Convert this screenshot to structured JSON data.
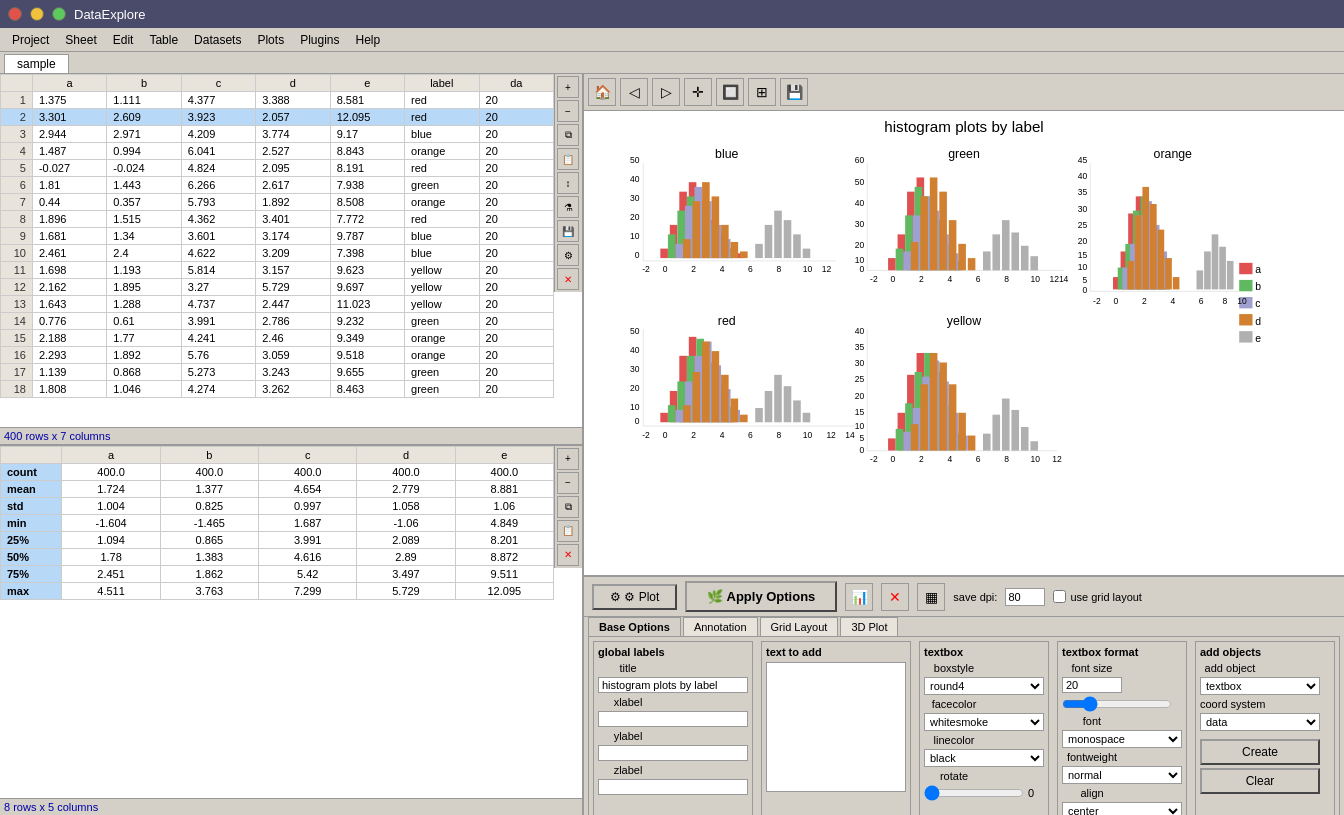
{
  "titlebar": {
    "title": "DataExplore"
  },
  "menu": {
    "items": [
      "Project",
      "Sheet",
      "Edit",
      "Table",
      "Datasets",
      "Plots",
      "Plugins",
      "Help"
    ]
  },
  "tab": {
    "label": "sample"
  },
  "table": {
    "columns": [
      "",
      "a",
      "b",
      "c",
      "d",
      "e",
      "label",
      "da"
    ],
    "rows": [
      [
        "1",
        "1.375",
        "1.111",
        "4.377",
        "3.388",
        "8.581",
        "red",
        "20"
      ],
      [
        "2",
        "3.301",
        "2.609",
        "3.923",
        "2.057",
        "12.095",
        "red",
        "20"
      ],
      [
        "3",
        "2.944",
        "2.971",
        "4.209",
        "3.774",
        "9.17",
        "blue",
        "20"
      ],
      [
        "4",
        "1.487",
        "0.994",
        "6.041",
        "2.527",
        "8.843",
        "orange",
        "20"
      ],
      [
        "5",
        "-0.027",
        "-0.024",
        "4.824",
        "2.095",
        "8.191",
        "red",
        "20"
      ],
      [
        "6",
        "1.81",
        "1.443",
        "6.266",
        "2.617",
        "7.938",
        "green",
        "20"
      ],
      [
        "7",
        "0.44",
        "0.357",
        "5.793",
        "1.892",
        "8.508",
        "orange",
        "20"
      ],
      [
        "8",
        "1.896",
        "1.515",
        "4.362",
        "3.401",
        "7.772",
        "red",
        "20"
      ],
      [
        "9",
        "1.681",
        "1.34",
        "3.601",
        "3.174",
        "9.787",
        "blue",
        "20"
      ],
      [
        "10",
        "2.461",
        "2.4",
        "4.622",
        "3.209",
        "7.398",
        "blue",
        "20"
      ],
      [
        "11",
        "1.698",
        "1.193",
        "5.814",
        "3.157",
        "9.623",
        "yellow",
        "20"
      ],
      [
        "12",
        "2.162",
        "1.895",
        "3.27",
        "5.729",
        "9.697",
        "yellow",
        "20"
      ],
      [
        "13",
        "1.643",
        "1.288",
        "4.737",
        "2.447",
        "11.023",
        "yellow",
        "20"
      ],
      [
        "14",
        "0.776",
        "0.61",
        "3.991",
        "2.786",
        "9.232",
        "green",
        "20"
      ],
      [
        "15",
        "2.188",
        "1.77",
        "4.241",
        "2.46",
        "9.349",
        "orange",
        "20"
      ],
      [
        "16",
        "2.293",
        "1.892",
        "5.76",
        "3.059",
        "9.518",
        "orange",
        "20"
      ],
      [
        "17",
        "1.139",
        "0.868",
        "5.273",
        "3.243",
        "9.655",
        "green",
        "20"
      ],
      [
        "18",
        "1.808",
        "1.046",
        "4.274",
        "3.262",
        "8.463",
        "green",
        "20"
      ]
    ],
    "row_info": "400 rows x 7 columns"
  },
  "stats": {
    "columns": [
      "",
      "a",
      "b",
      "c",
      "d",
      "e"
    ],
    "rows": [
      [
        "count",
        "400.0",
        "400.0",
        "400.0",
        "400.0",
        "400.0"
      ],
      [
        "mean",
        "1.724",
        "1.377",
        "4.654",
        "2.779",
        "8.881"
      ],
      [
        "std",
        "1.004",
        "0.825",
        "0.997",
        "1.058",
        "1.06"
      ],
      [
        "min",
        "-1.604",
        "-1.465",
        "1.687",
        "-1.06",
        "4.849"
      ],
      [
        "25%",
        "1.094",
        "0.865",
        "3.991",
        "2.089",
        "8.201"
      ],
      [
        "50%",
        "1.78",
        "1.383",
        "4.616",
        "2.89",
        "8.872"
      ],
      [
        "75%",
        "2.451",
        "1.862",
        "5.42",
        "3.497",
        "9.511"
      ],
      [
        "max",
        "4.511",
        "3.763",
        "7.299",
        "5.729",
        "12.095"
      ]
    ],
    "row_info": "8 rows x 5 columns"
  },
  "plot": {
    "title": "histogram plots by label",
    "subplots": [
      "blue",
      "green",
      "orange",
      "red",
      "yellow"
    ]
  },
  "controls": {
    "plot_btn": "⚙ Plot",
    "apply_options_btn": "Apply Options",
    "save_dpi_label": "save dpi:",
    "save_dpi_value": "80",
    "use_grid_layout": "use grid layout",
    "grid_layout_label": "Grid Layout",
    "tabs": [
      "Base Options",
      "Annotation",
      "Grid Layout",
      "3D Plot"
    ],
    "global_labels": {
      "label": "global labels",
      "title_label": "title",
      "title_value": "histogram plots by label",
      "xlabel_label": "xlabel",
      "ylabel_label": "ylabel",
      "zlabel_label": "zlabel"
    },
    "text_to_add": {
      "label": "text to add"
    },
    "textbox": {
      "label": "textbox",
      "boxstyle_label": "boxstyle",
      "boxstyle_value": "round4",
      "facecolor_label": "facecolor",
      "facecolor_value": "whitesmoke",
      "linecolor_label": "linecolor",
      "linecolor_value": "black",
      "rotate_label": "rotate",
      "rotate_value": "0"
    },
    "textbox_format": {
      "label": "textbox format",
      "font_size_label": "font size",
      "font_size_value": "20",
      "font_label": "font",
      "font_value": "monospace",
      "fontweight_label": "fontweight",
      "fontweight_value": "normal",
      "align_label": "align",
      "align_value": "center"
    },
    "add_objects": {
      "label": "add objects",
      "add_object_label": "add object",
      "add_object_value": "textbox",
      "coord_system_label": "coord system",
      "coord_system_value": "data",
      "create_btn": "Create",
      "clear_btn": "Clear"
    }
  }
}
